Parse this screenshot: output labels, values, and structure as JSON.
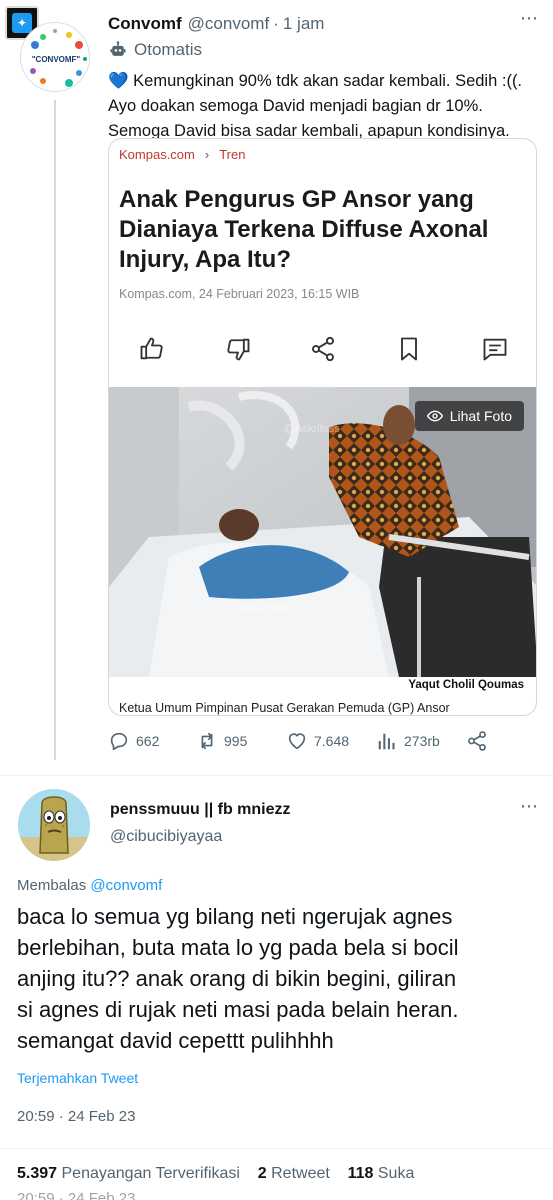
{
  "tweet1": {
    "display_name": "Convomf",
    "handle": "@convomf",
    "separator": "·",
    "time": "1 jam",
    "automated_label": "Otomatis",
    "avatar_text": "\"CONVOMF\"",
    "emoji": "💙",
    "text_lines": [
      "Kemungkinan 90% tdk akan sadar kembali. Sedih :((.",
      "Ayo doakan semoga David menjadi bagian dr 10%.",
      "Semoga David bisa sadar kembali, apapun kondisinya."
    ],
    "card": {
      "source": "Kompas.com",
      "breadcrumb_sep": "›",
      "section": "Tren",
      "headline": "Anak Pengurus GP Ansor yang Dianiaya Terkena Diffuse Axonal Injury, Apa Itu?",
      "byline": "Kompas.com, 24 Februari 2023, 16:15 WIB",
      "photo_button": "Lihat Foto",
      "watermark": "@Askrlfess",
      "photo_credit": "Yaqut Cholil Qoumas",
      "photo_description": "Ketua Umum Pimpinan Pusat Gerakan Pemuda (GP) Ansor"
    },
    "metrics": {
      "replies": "662",
      "retweets": "995",
      "likes": "7.648",
      "views": "273rb"
    }
  },
  "tweet2": {
    "display_name": "penssmuuu || fb mniezz",
    "handle": "@cibucibiyayaa",
    "replying_prefix": "Membalas",
    "replying_to": "@convomf",
    "text_lines": [
      "baca lo semua yg bilang neti ngerujak agnes",
      "berlebihan, buta mata lo yg pada bela si bocil",
      "anjing itu?? anak orang di bikin begini, giliran",
      "si agnes di rujak neti masi pada belain heran.",
      "semangat david cepettt pulihhhh"
    ],
    "translate_label": "Terjemahkan Tweet",
    "timestamp": "20:59 · 24 Feb 23",
    "views_count": "5.397",
    "views_label": "Penayangan Terverifikasi",
    "retweets_count": "2",
    "retweets_label": "Retweet",
    "likes_count": "118",
    "likes_label": "Suka",
    "ghost_timestamp": "20:59 · 24 Feb 23"
  },
  "icons": {
    "more": "more-dots-icon",
    "automated": "bot-icon",
    "reply": "reply-icon",
    "retweet": "retweet-icon",
    "like": "heart-icon",
    "views": "views-bar-chart-icon",
    "share": "share-icon"
  },
  "colors": {
    "accent": "#1d9bf0",
    "text_primary": "#0f1419",
    "text_secondary": "#536471",
    "kompas_red": "#c0392b",
    "border": "#cfd9de"
  }
}
